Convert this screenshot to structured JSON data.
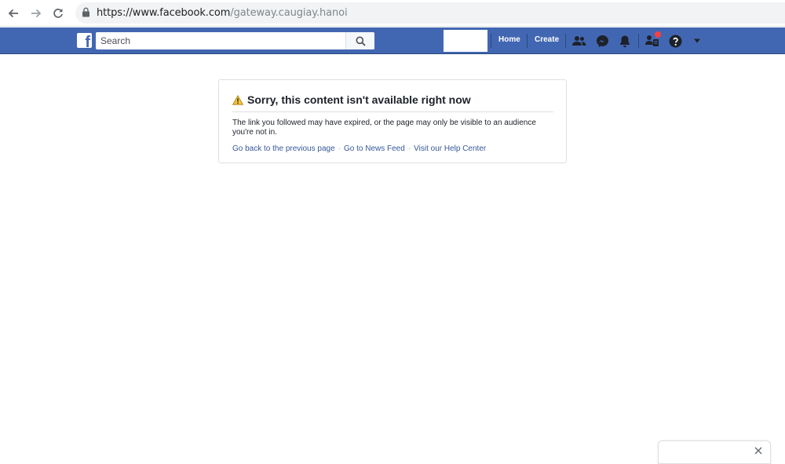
{
  "browser": {
    "url_main": "https://www.facebook.com",
    "url_path": "/gateway.caugiay.hanoi"
  },
  "header": {
    "search_placeholder": "Search",
    "home_label": "Home",
    "create_label": "Create",
    "logo_letter": "f"
  },
  "error": {
    "title": "Sorry, this content isn't available right now",
    "message": "The link you followed may have expired, or the page may only be visible to an audience you're not in.",
    "links": [
      "Go back to the previous page",
      "Go to News Feed",
      "Visit our Help Center"
    ],
    "separator": "·"
  },
  "colors": {
    "brand_blue": "#4267b2",
    "link_blue": "#365899",
    "warning_yellow": "#f5c33b",
    "notification_red": "#fa3e3e"
  },
  "icons": [
    "back-arrow-icon",
    "forward-arrow-icon",
    "reload-icon",
    "lock-icon",
    "search-icon",
    "friends-icon",
    "messenger-icon",
    "notifications-bell-icon",
    "quick-help-icon",
    "help-question-icon",
    "caret-down-icon",
    "warning-icon",
    "close-icon"
  ]
}
